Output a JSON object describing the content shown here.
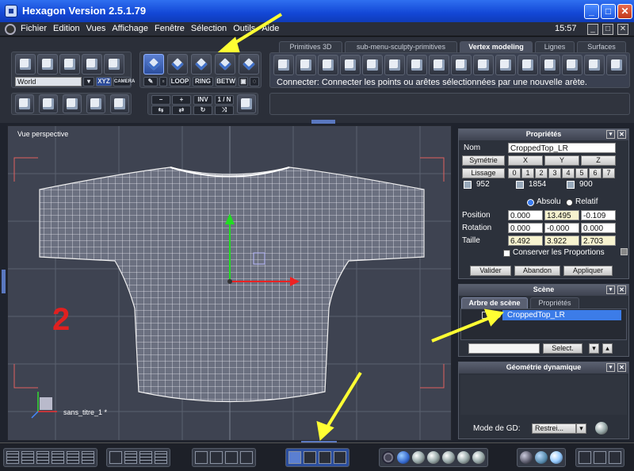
{
  "window": {
    "title": "Hexagon Version 2.5.1.79"
  },
  "menu": {
    "items": [
      "Fichier",
      "Edition",
      "Vues",
      "Affichage",
      "Fenêtre",
      "Sélection",
      "Outils",
      "Aide"
    ],
    "clock": "15:57"
  },
  "toolbar": {
    "coord_select": "World",
    "xyz_label": "XYZ",
    "camera_label": "CAMERA",
    "loop_label": "LOOP",
    "ring_label": "RING",
    "betw_label": "BETW",
    "minus_label": "−",
    "plus_label": "+",
    "inv_label": "INV",
    "ratio_label": "1 / N"
  },
  "tabs": [
    {
      "label": "Primitives 3D",
      "active": false
    },
    {
      "label": "sub-menu-sculpty-primitives",
      "active": false
    },
    {
      "label": "Vertex modeling",
      "active": true
    },
    {
      "label": "Lignes",
      "active": false
    },
    {
      "label": "Surfaces",
      "active": false
    }
  ],
  "status_message": "Connecter: Connecter les points ou arêtes sélectionnées par une nouvelle arète.",
  "viewport": {
    "label": "Vue perspective",
    "overlay_number": "2",
    "file_label": "sans_titre_1 *"
  },
  "properties": {
    "header": "Propriétés",
    "name_label": "Nom",
    "name_value": "CroppedTop_LR",
    "symmetry_label": "Symétrie",
    "sym_axes": [
      "X",
      "Y",
      "Z"
    ],
    "smoothing_label": "Lissage",
    "smoothing_levels": [
      "0",
      "1",
      "2",
      "3",
      "4",
      "5",
      "6",
      "7"
    ],
    "counts": [
      "952",
      "1854",
      "900"
    ],
    "absolute_label": "Absolu",
    "relative_label": "Relatif",
    "position_label": "Position",
    "position": [
      "0.000",
      "13.495",
      "-0.109"
    ],
    "rotation_label": "Rotation",
    "rotation": [
      "0.000",
      "-0.000",
      "0.000"
    ],
    "size_label": "Taille",
    "size": [
      "6.492",
      "3.922",
      "2.703"
    ],
    "keep_proportions_label": "Conserver les Proportions",
    "validate_label": "Valider",
    "abandon_label": "Abandon",
    "apply_label": "Appliquer"
  },
  "scene": {
    "header": "Scène",
    "tab_tree": "Arbre de scène",
    "tab_props": "Propriétés",
    "item": "CroppedTop_LR",
    "select_label": "Select."
  },
  "dyn_geometry": {
    "header": "Géométrie dynamique",
    "mode_label": "Mode de GD:",
    "mode_value": "Restrei..."
  },
  "colors": {
    "annotation_arrow": "#ffff33",
    "overlay_number": "#e02020",
    "title_bar": "#1347d6"
  }
}
